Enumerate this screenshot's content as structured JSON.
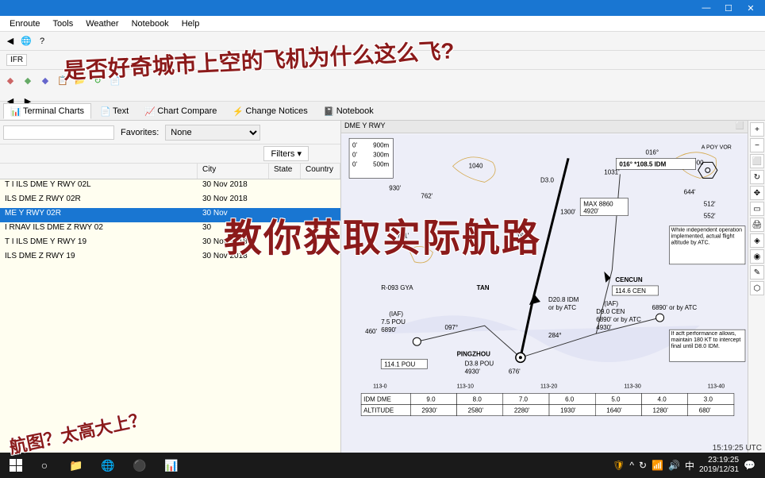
{
  "menu": {
    "items": [
      "Enroute",
      "Tools",
      "Weather",
      "Notebook",
      "Help"
    ]
  },
  "flight_rule": "IFR",
  "tabs": {
    "items": [
      {
        "label": "Terminal Charts",
        "icon": "📊"
      },
      {
        "label": "Text",
        "icon": "📄"
      },
      {
        "label": "Chart Compare",
        "icon": "📈"
      },
      {
        "label": "Change Notices",
        "icon": "⚡"
      },
      {
        "label": "Notebook",
        "icon": "📓"
      }
    ]
  },
  "filters": {
    "favorites_label": "Favorites:",
    "favorites_value": "None",
    "filters_btn": "Filters ▾"
  },
  "list": {
    "headers": {
      "name": "",
      "city": "City",
      "state": "State",
      "country": "Country"
    },
    "rows": [
      {
        "name": "T I ILS DME Y RWY 02L",
        "city": "30 Nov 2018"
      },
      {
        "name": "ILS DME Z RWY 02R",
        "city": "30 Nov 2018"
      },
      {
        "name": "ME Y RWY 02R",
        "city": "30 Nov",
        "selected": true
      },
      {
        "name": "I RNAV ILS DME Z RWY 02",
        "city": "30"
      },
      {
        "name": "T I ILS DME Y RWY 19",
        "city": "30 Nov 2018"
      },
      {
        "name": "ILS DME Z RWY 19",
        "city": "30 Nov 2018"
      }
    ]
  },
  "chart": {
    "header": "DME Y RWY",
    "navaids": {
      "idm_freq": "016° *108.5 IDM",
      "pou": "114.1 POU",
      "cen": "114.6 CEN",
      "pingzhou": "PINGZHOU",
      "cencun": "CENCUN",
      "gya": "R-093 GYA"
    },
    "fixes": {
      "d30": "D3.0",
      "d38": "D3.8 POU",
      "d75": "7.5 POU",
      "d90": "D9.0 CEN",
      "d208": "D20.8 IDM",
      "iaf": "(IAF)",
      "tan": "TAN"
    },
    "altitudes": {
      "a900": "900m",
      "a300": "300m",
      "a500": "500m",
      "a930": "930'",
      "a4930p": "4930'",
      "a4930c": "4930'",
      "a6890p": "6890'",
      "a6890c": "6890' or by ATC",
      "max8860": "MAX 8860",
      "a4920": "4920'"
    },
    "bearings": {
      "b791": "791'",
      "b762": "762'",
      "b460": "460'",
      "b097": "097°",
      "b284": "284°",
      "b676": "676'",
      "b016": "016°",
      "b1031": "1031'",
      "b1846": "1846'",
      "b644": "644'",
      "b512": "512'",
      "b552": "552'",
      "b1300": "1300'",
      "b1000": "1000"
    },
    "notes": {
      "independent": "While independent operation implemented, actual flight altitude by ATC.",
      "performance": "If acft performance allows, maintain 180 KT to intercept final until D8.0 IDM."
    },
    "table": {
      "dme_row": "IDM DME",
      "alt_row": "ALTITUDE",
      "cols": [
        "9.0",
        "8.0",
        "7.0",
        "6.0",
        "5.0",
        "4.0",
        "3.0"
      ],
      "alts": [
        "2930'",
        "2580'",
        "2280'",
        "1930'",
        "1640'",
        "1280'",
        "680'"
      ],
      "miles": [
        "113-0",
        "113-10",
        "113-20",
        "113-30",
        "113-40"
      ]
    }
  },
  "overlay": {
    "main": "教你获取实际航路",
    "top": "是否好奇城市上空的飞机为什么这么飞?",
    "bottom_left": "航图？太高大上？"
  },
  "status": {
    "utc": "15:19:25 UTC"
  },
  "taskbar": {
    "time": "23:19:25",
    "date": "2019/12/31"
  }
}
